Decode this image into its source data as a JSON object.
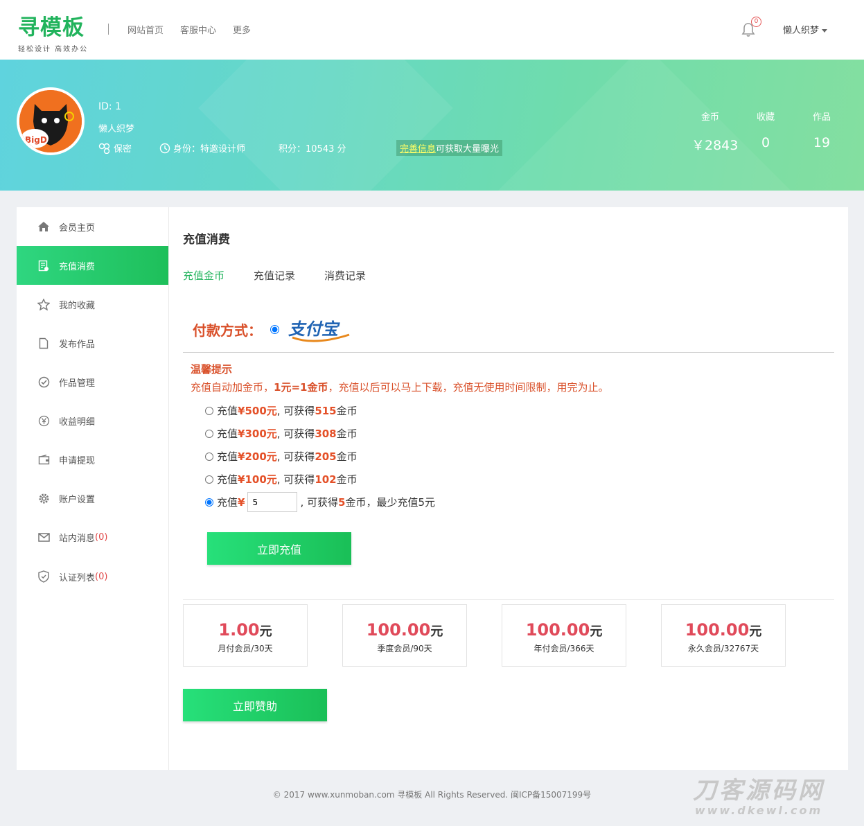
{
  "header": {
    "logo_main": "寻模板",
    "logo_sub": "轻松设计 高效办公",
    "nav": [
      "网站首页",
      "客服中心",
      "更多"
    ],
    "notification_count": "0",
    "user_menu": "懒人织梦",
    "bell_icon": "bell-icon"
  },
  "profile": {
    "avatar_text": "BigD",
    "id": "ID: 1",
    "name": "懒人织梦",
    "privacy": "保密",
    "role": "身份：特邀设计师",
    "points": "积分：10543 分",
    "notice_link": "完善信息",
    "notice_text": "可获取大量曝光",
    "stats": [
      {
        "label": "金币",
        "value": "￥2843"
      },
      {
        "label": "收藏",
        "value": "0"
      },
      {
        "label": "作品",
        "value": "19"
      }
    ]
  },
  "sidebar": {
    "items": [
      {
        "label": "会员主页",
        "icon": "home-icon"
      },
      {
        "label": "充值消费",
        "icon": "bill-icon"
      },
      {
        "label": "我的收藏",
        "icon": "star-icon"
      },
      {
        "label": "发布作品",
        "icon": "file-icon"
      },
      {
        "label": "作品管理",
        "icon": "check-circle-icon"
      },
      {
        "label": "收益明细",
        "icon": "yen-circle-icon"
      },
      {
        "label": "申请提现",
        "icon": "wallet-icon"
      },
      {
        "label": "账户设置",
        "icon": "gear-icon"
      },
      {
        "label": "站内消息",
        "count": "(0)",
        "icon": "mail-icon"
      },
      {
        "label": "认证列表",
        "count": "(0)",
        "icon": "shield-icon"
      }
    ],
    "active_index": 1
  },
  "main": {
    "title": "充值消费",
    "tabs": [
      "充值金币",
      "充值记录",
      "消费记录"
    ],
    "pay_label": "付款方式：",
    "alipay_text": "支付宝",
    "tip_title": "温馨提示",
    "tip_pre": "充值自动加金币，",
    "tip_bold": "1元=1金币",
    "tip_post": "，充值以后可以马上下载，充值无使用时间限制，用完为止。",
    "options": [
      {
        "pre": "充值 ",
        "amount": "¥500元",
        "mid": ", 可获得 ",
        "coins": "515",
        "post": " 金币"
      },
      {
        "pre": "充值 ",
        "amount": "¥300元",
        "mid": ", 可获得 ",
        "coins": "308",
        "post": " 金币"
      },
      {
        "pre": "充值 ",
        "amount": "¥200元",
        "mid": ", 可获得 ",
        "coins": "205",
        "post": " 金币"
      },
      {
        "pre": "充值 ",
        "amount": "¥100元",
        "mid": ", 可获得 ",
        "coins": "102",
        "post": " 金币"
      }
    ],
    "custom": {
      "pre": "充值 ",
      "currency": "¥",
      "value": "5",
      "mid": " , 可获得 ",
      "coins": "5",
      "post": " 金币，最少充值5元"
    },
    "recharge_button": "立即充值",
    "plans": [
      {
        "price": "1.00",
        "unit": "元",
        "label": "月付会员/30天"
      },
      {
        "price": "100.00",
        "unit": "元",
        "label": "季度会员/90天"
      },
      {
        "price": "100.00",
        "unit": "元",
        "label": "年付会员/366天"
      },
      {
        "price": "100.00",
        "unit": "元",
        "label": "永久会员/32767天"
      }
    ],
    "sponsor_button": "立即赞助"
  },
  "footer": {
    "copyright": "© 2017 www.xunmoban.com 寻模板 All Rights Reserved. 闽ICP备15007199号"
  },
  "watermark": {
    "line1": "刀客源码网",
    "line2": "www.dkewl.com"
  },
  "colors": {
    "brand_green": "#21b35c",
    "warn_orange": "#d9502a",
    "price_red": "#e04a5a"
  }
}
